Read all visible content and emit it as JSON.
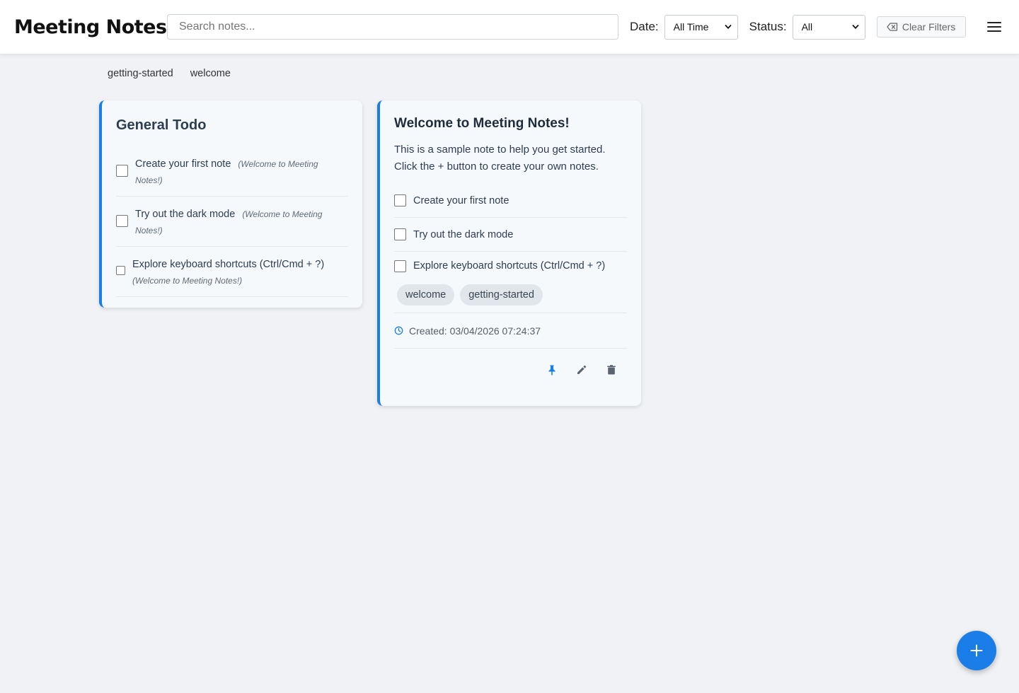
{
  "header": {
    "title": "Meeting Notes",
    "search_placeholder": "Search notes...",
    "date_label": "Date:",
    "date_value": "All Time",
    "status_label": "Status:",
    "status_value": "All",
    "clear_filters_label": "Clear Filters"
  },
  "tag_filters": [
    "getting-started",
    "welcome"
  ],
  "todo_card": {
    "title": "General Todo",
    "items": [
      {
        "text": "Create your first note",
        "source": "(Welcome to Meeting Notes!)"
      },
      {
        "text": "Try out the dark mode",
        "source": "(Welcome to Meeting Notes!)"
      },
      {
        "text": "Explore keyboard shortcuts (Ctrl/Cmd + ?)",
        "source": "(Welcome to Meeting Notes!)"
      }
    ]
  },
  "note_card": {
    "title": "Welcome to Meeting Notes!",
    "body_line1": "This is a sample note to help you get started.",
    "body_line2": "Click the + button to create your own notes.",
    "checklist": [
      "Create your first note",
      "Try out the dark mode",
      "Explore keyboard shortcuts (Ctrl/Cmd + ?)"
    ],
    "tags": [
      "welcome",
      "getting-started"
    ],
    "created": "Created: 03/04/2026 07:24:37"
  },
  "icons": {
    "pin": "pin-icon",
    "edit": "pencil-icon",
    "delete": "trash-icon",
    "clock": "clock-icon",
    "add": "plus-icon"
  },
  "colors": {
    "accent": "#1a7de8",
    "background": "#f0f2f5",
    "card": "#f6f9fc"
  }
}
